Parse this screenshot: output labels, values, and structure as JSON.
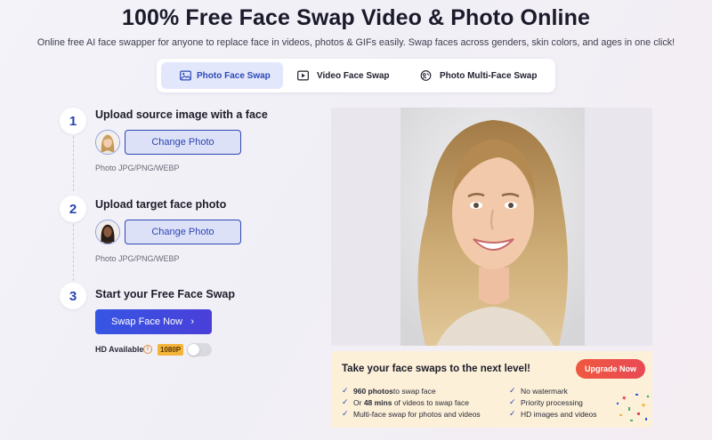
{
  "header": {
    "title": "100% Free Face Swap Video & Photo Online",
    "subtitle": "Online free AI face swapper for anyone to replace face in videos, photos & GIFs easily. Swap faces across genders, skin colors, and ages in one click!"
  },
  "tabs": [
    {
      "label": "Photo Face Swap",
      "icon": "image-icon",
      "active": true
    },
    {
      "label": "Video Face Swap",
      "icon": "video-icon",
      "active": false
    },
    {
      "label": "Photo Multi-Face Swap",
      "icon": "multi-face-icon",
      "active": false
    }
  ],
  "steps": [
    {
      "number": "1",
      "title": "Upload source image with a face",
      "button": "Change Photo",
      "hint": "Photo JPG/PNG/WEBP"
    },
    {
      "number": "2",
      "title": "Upload target face photo",
      "button": "Change Photo",
      "hint": "Photo JPG/PNG/WEBP"
    },
    {
      "number": "3",
      "title": "Start your Free Face Swap",
      "button": "Swap Face Now"
    }
  ],
  "hd": {
    "label": "HD Available",
    "badge": "1080P",
    "enabled": false
  },
  "promo": {
    "title": "Take your face swaps to the next level!",
    "button": "Upgrade Now",
    "features_left": [
      {
        "bold": "960 photos",
        "text": " to swap face",
        "prefix": ""
      },
      {
        "prefix": "Or ",
        "bold": "48 mins",
        "text": " of videos to swap face"
      },
      {
        "prefix": "",
        "bold": "",
        "text": "Multi-face swap for photos and videos"
      }
    ],
    "features_right": [
      "No watermark",
      "Priority processing",
      "HD images and videos"
    ]
  },
  "colors": {
    "accent": "#2d49b8",
    "swap_button": "#3656e4",
    "upgrade_button": "#f0583e",
    "promo_bg": "#fcf0d8"
  }
}
